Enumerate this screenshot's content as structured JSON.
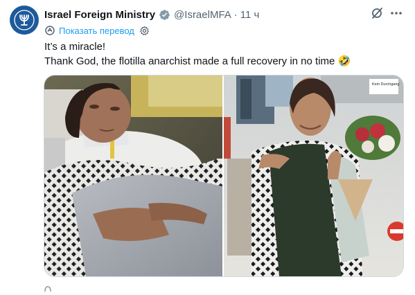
{
  "tweet": {
    "author_name": "Israel Foreign Ministry",
    "handle": "@IsraelMFA",
    "separator": "·",
    "time": "11 ч",
    "translate_label": "Показать перевод",
    "text_lines": [
      "It’s a miracle!",
      "Thank God, the flotilla anarchist made a full recovery in no time 🤣"
    ]
  },
  "media": {
    "left_image": "woman-lying-in-hospital-bed-with-neck-brace",
    "right_image": "woman-smiling-with-flowers-at-airport",
    "right_sign_text": "Kein Durchgang"
  },
  "icons": {
    "verified": "verified-badge-icon",
    "grok": "grok-icon",
    "more": "more-icon",
    "translate": "translate-icon",
    "settings": "gear-icon"
  },
  "colors": {
    "accent": "#1d9bf0",
    "muted": "#536471",
    "avatar_bg": "#1d5a9b"
  }
}
